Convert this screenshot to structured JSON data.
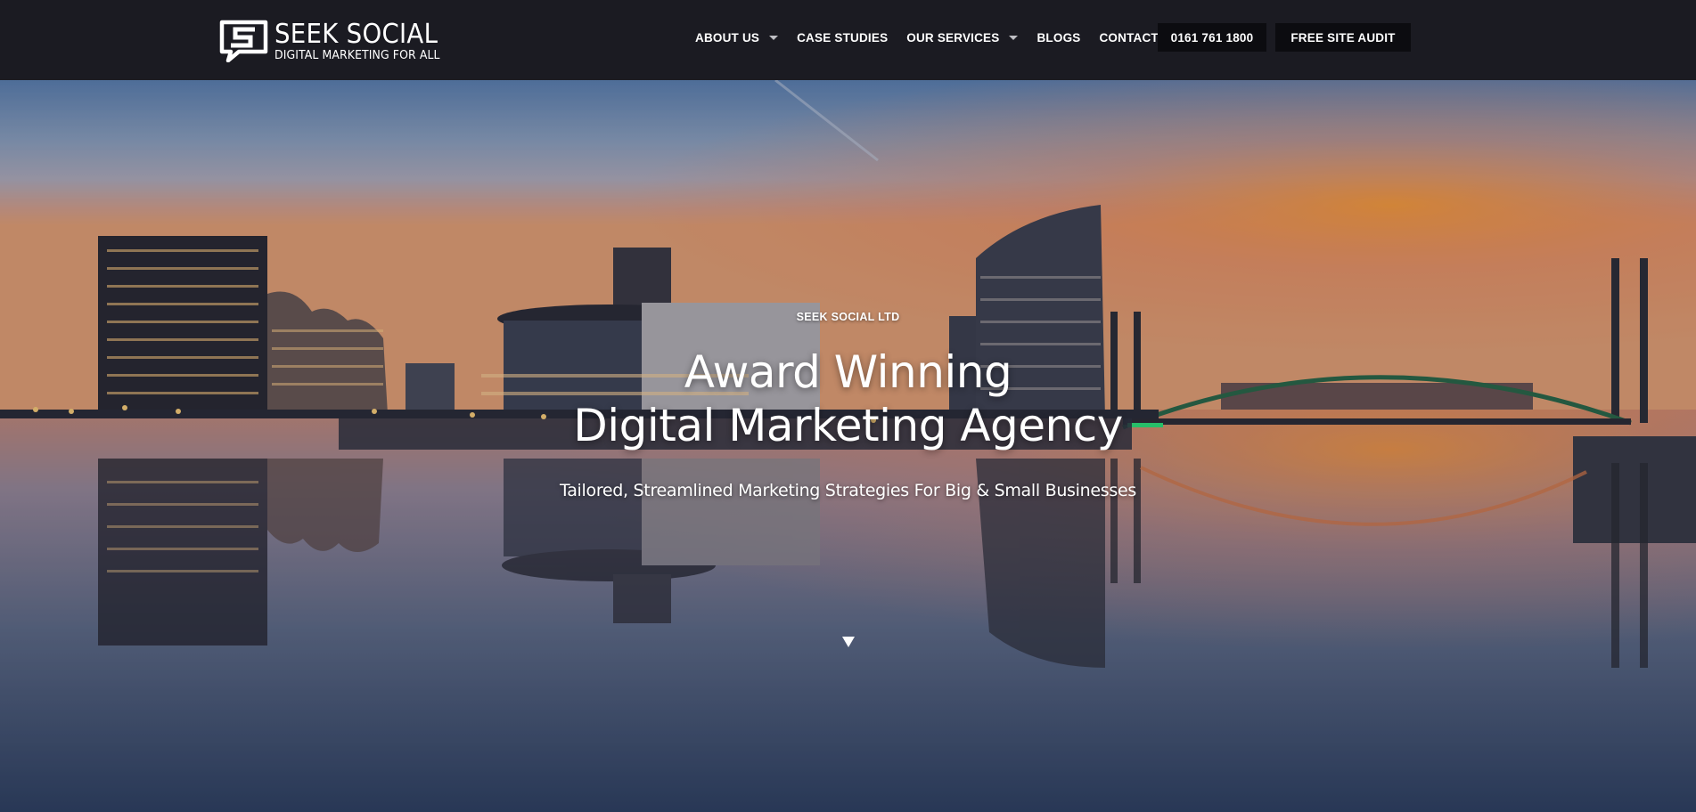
{
  "brand": {
    "name": "SEEK SOCIAL",
    "tagline": "DIGITAL MARKETING FOR ALL",
    "logo_icon": "speech-bubble-s-logo"
  },
  "nav": {
    "items": [
      {
        "label": "ABOUT US",
        "dropdown": true
      },
      {
        "label": "CASE STUDIES",
        "dropdown": false
      },
      {
        "label": "OUR SERVICES",
        "dropdown": true
      },
      {
        "label": "BLOGS",
        "dropdown": false
      },
      {
        "label": "CONTACT US",
        "dropdown": false
      }
    ],
    "phone_button": "0161 761 1800",
    "audit_button": "FREE SITE AUDIT"
  },
  "hero": {
    "eyebrow": "SEEK SOCIAL LTD",
    "headline_line1": "Award Winning",
    "headline_line2": "Digital Marketing Agency",
    "subheadline": "Tailored, Streamlined Marketing Strategies For Big & Small Businesses",
    "scroll_icon": "triangle-down-icon",
    "background_image": "city waterfront skyline at sunset with bridge and reflections"
  },
  "colors": {
    "nav_background": "#1b1b22",
    "button_background": "#0c0c10",
    "text": "#ffffff"
  }
}
